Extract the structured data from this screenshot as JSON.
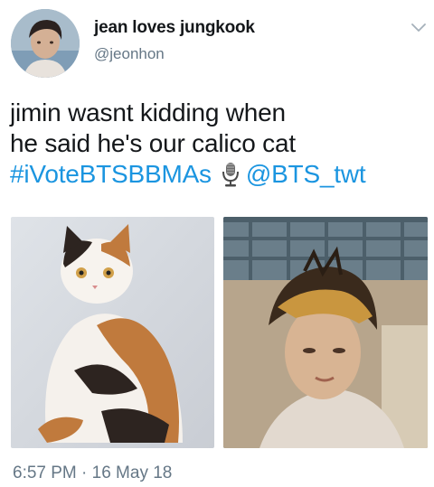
{
  "tweet": {
    "author": {
      "display_name": "jean loves jungkook",
      "handle": "@jeonhon",
      "avatar_icon": "profile-photo"
    },
    "menu_icon": "chevron-down-icon",
    "text": {
      "line1": "jimin wasnt kidding when",
      "line2": "he said he's our calico cat",
      "hashtag": "#iVoteBTSBBMAs",
      "emoji": "microphone",
      "mention": "@BTS_twt"
    },
    "media": [
      {
        "alt_icon": "calico-cat-photo"
      },
      {
        "alt_icon": "person-photo"
      }
    ],
    "timestamp": "6:57 PM · 16 May 18"
  },
  "colors": {
    "link": "#1b95e0",
    "text": "#14171a",
    "muted": "#657786",
    "background": "#ffffff"
  }
}
